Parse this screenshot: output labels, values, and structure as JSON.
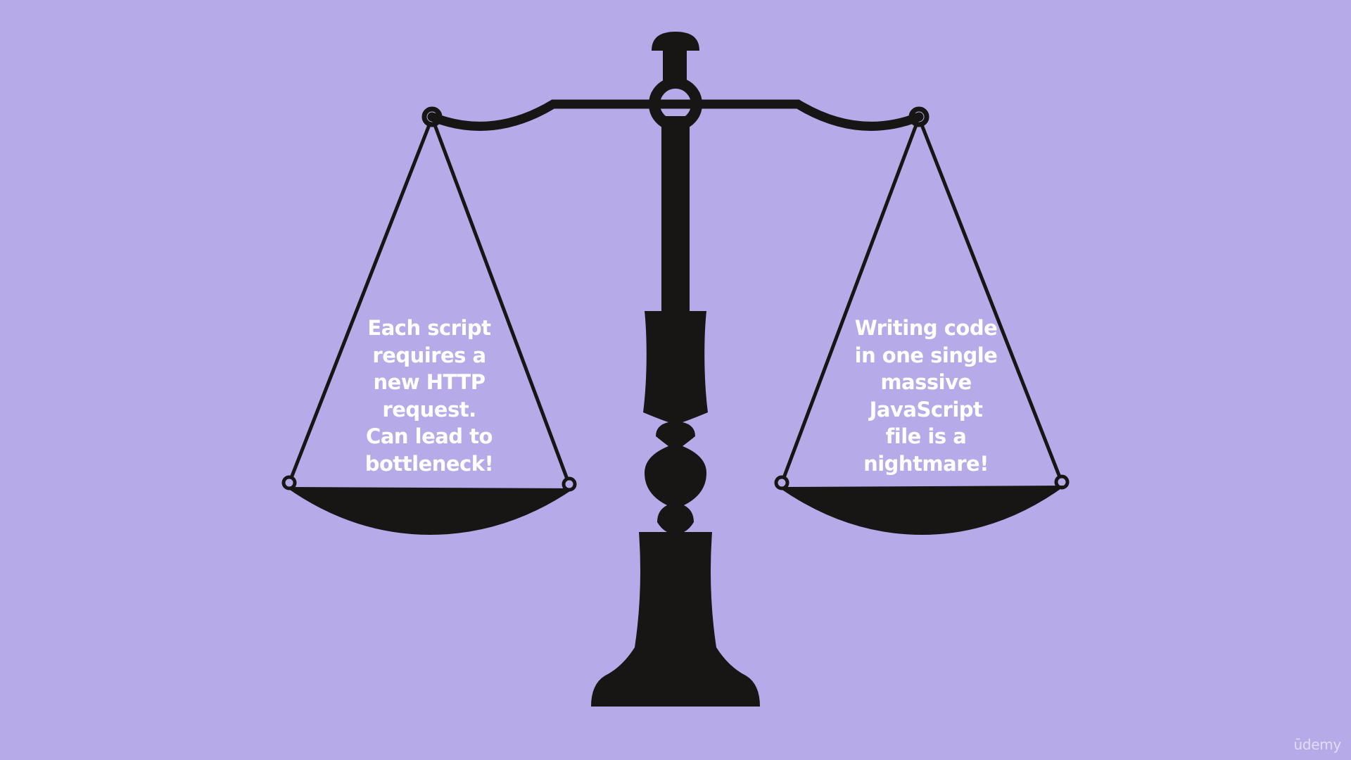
{
  "slide": {
    "background_color": "#b6abe8",
    "ink_color": "#181614",
    "text_color": "#ffffff",
    "left_pan_text": "Each script\nrequires a\nnew HTTP\nrequest.\nCan lead to\nbottleneck!",
    "right_pan_text": "Writing code\nin one single\nmassive\nJavaScript\nfile is a\nnightmare!"
  },
  "branding": {
    "logo_text": "ūdemy"
  }
}
